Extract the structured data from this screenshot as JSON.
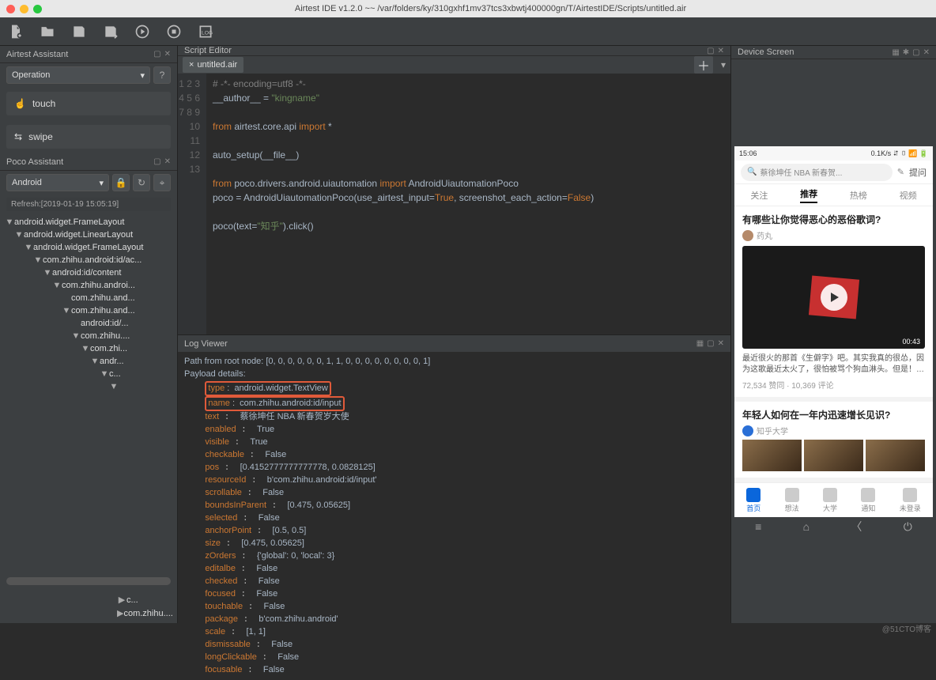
{
  "title": "Airtest IDE v1.2.0 ~~ /var/folders/ky/310gxhf1mv37tcs3xbwtj400000gn/T/AirtestIDE/Scripts/untitled.air",
  "panels": {
    "assistant": "Airtest Assistant",
    "operation": "Operation",
    "touch": "touch",
    "swipe": "swipe",
    "poco": "Poco Assistant",
    "android": "Android",
    "refresh": "Refresh:[2019-01-19 15:05:19]",
    "script": "Script Editor",
    "tab": "untitled.air",
    "log": "Log Viewer",
    "device": "Device Screen"
  },
  "tree": [
    {
      "d": 0,
      "t": "android.widget.FrameLayout",
      "a": "▼"
    },
    {
      "d": 1,
      "t": "android.widget.LinearLayout",
      "a": "▼"
    },
    {
      "d": 2,
      "t": "android.widget.FrameLayout",
      "a": "▼"
    },
    {
      "d": 3,
      "t": "com.zhihu.android:id/ac...",
      "a": "▼"
    },
    {
      "d": 4,
      "t": "android:id/content",
      "a": "▼"
    },
    {
      "d": 5,
      "t": "com.zhihu.androi...",
      "a": "▼"
    },
    {
      "d": 6,
      "t": "com.zhihu.and...",
      "a": ""
    },
    {
      "d": 6,
      "t": "com.zhihu.and...",
      "a": "▼"
    },
    {
      "d": 7,
      "t": "android:id/...",
      "a": ""
    },
    {
      "d": 7,
      "t": "com.zhihu....",
      "a": "▼"
    },
    {
      "d": 8,
      "t": "com.zhi...",
      "a": "▼"
    },
    {
      "d": 9,
      "t": "andr...",
      "a": "▼"
    },
    {
      "d": 10,
      "t": "c...",
      "a": "▼"
    },
    {
      "d": 11,
      "t": "",
      "a": "▼"
    },
    {
      "d": 12,
      "t": "",
      "a": ""
    }
  ],
  "tree_bottom": [
    {
      "a": "▶",
      "t": "c..."
    },
    {
      "a": "▶",
      "t": "com.zhihu...."
    }
  ],
  "code": {
    "lines": [
      "1",
      "2",
      "3",
      "4",
      "5",
      "6",
      "7",
      "8",
      "9",
      "10",
      "11",
      "12",
      "13"
    ],
    "l1": "# -*- encoding=utf8 -*-",
    "l2a": "__author__ = ",
    "l2b": "\"kingname\"",
    "l4a": "from",
    "l4b": " airtest.core.api ",
    "l4c": "import",
    "l4d": " *",
    "l6": "auto_setup(__file__)",
    "l8a": "from",
    "l8b": " poco.drivers.android.uiautomation ",
    "l8c": "import",
    "l8d": " AndroidUiautomationPoco",
    "l9a": "poco = AndroidUiautomationPoco(use_airtest_input=",
    "l9b": "True",
    "l9c": ", screenshot_each_action=",
    "l9d": "False",
    "l9e": ")",
    "l11a": "poco(text=",
    "l11b": "\"知乎\"",
    "l11c": ").click()"
  },
  "log": {
    "path": "Path from root node: [0, 0, 0, 0, 0, 0, 1, 1, 0, 0, 0, 0, 0, 0, 0, 0, 1]",
    "payload": "Payload details:",
    "rows": [
      [
        "type",
        "android.widget.TextView"
      ],
      [
        "name",
        "com.zhihu.android:id/input"
      ],
      [
        "text",
        "蔡徐坤任 NBA 新春贺岁大使"
      ],
      [
        "enabled",
        "True"
      ],
      [
        "visible",
        "True"
      ],
      [
        "checkable",
        "False"
      ],
      [
        "pos",
        "[0.4152777777777778, 0.0828125]"
      ],
      [
        "resourceId",
        "b'com.zhihu.android:id/input'"
      ],
      [
        "scrollable",
        "False"
      ],
      [
        "boundsInParent",
        "[0.475, 0.05625]"
      ],
      [
        "selected",
        "False"
      ],
      [
        "anchorPoint",
        "[0.5, 0.5]"
      ],
      [
        "size",
        "[0.475, 0.05625]"
      ],
      [
        "zOrders",
        "{'global': 0, 'local': 3}"
      ],
      [
        "editalbe",
        "False"
      ],
      [
        "checked",
        "False"
      ],
      [
        "focused",
        "False"
      ],
      [
        "touchable",
        "False"
      ],
      [
        "package",
        "b'com.zhihu.android'"
      ],
      [
        "scale",
        "[1, 1]"
      ],
      [
        "dismissable",
        "False"
      ],
      [
        "longClickable",
        "False"
      ],
      [
        "focusable",
        "False"
      ]
    ]
  },
  "phone": {
    "time": "15:06",
    "status": "0.1K/s ⮃ ▯ 📶 🔋",
    "search": "蔡徐坤任 NBA 新春贺...",
    "ask": "提问",
    "tabs": [
      "关注",
      "推荐",
      "热榜",
      "视频"
    ],
    "card1_title": "有哪些让你觉得恶心的恶俗歌词?",
    "card1_author": "药丸",
    "card1_duration": "00:43",
    "card1_desc": "最近很火的那首《生僻字》吧。其实我真的很怂，因为这歌最近太火了，很怕被骂个狗血淋头。但是！…",
    "card1_meta": "72,534 赞同 · 10,369 评论",
    "card2_title": "年轻人如何在一年内迅速增长见识?",
    "card2_author": "知乎大学",
    "bottom": [
      "首页",
      "想法",
      "大学",
      "通知",
      "未登录"
    ]
  },
  "watermark": "@51CTO博客"
}
